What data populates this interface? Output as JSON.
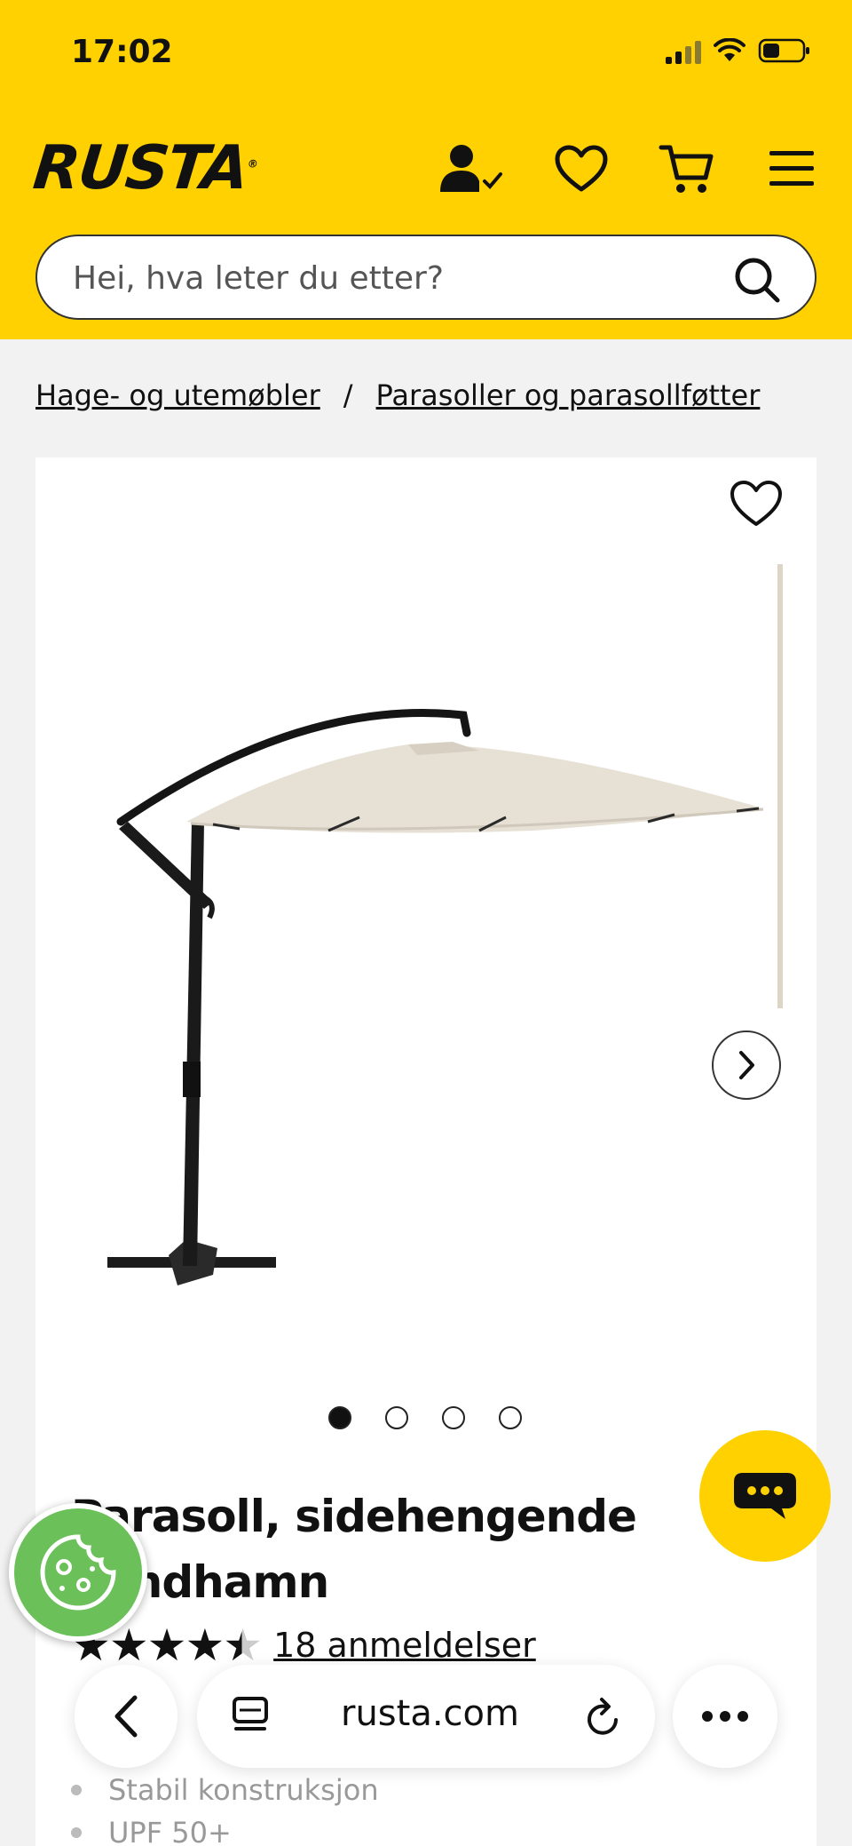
{
  "status_bar": {
    "time": "17:02"
  },
  "header": {
    "logo": "RUSTA",
    "search": {
      "placeholder": "Hei, hva leter du etter?",
      "value": ""
    },
    "colors": {
      "brand": "#ffd100"
    },
    "icons": [
      "account-check-icon",
      "heart-icon",
      "cart-icon",
      "menu-icon"
    ]
  },
  "breadcrumb": {
    "items": [
      {
        "label": "Hage- og utemøbler"
      },
      {
        "label": "Parasoller og parasollføtter"
      }
    ],
    "separator": "/"
  },
  "product": {
    "title": "Parasoll, sidehengende Sandhamn",
    "rating": {
      "stars": 4.5,
      "max": 5
    },
    "reviews_label": "18 anmeldelser",
    "gallery": {
      "image_count": 4,
      "active_index": 0
    },
    "features": [
      "Stabil konstruksjon",
      "UPF 50+"
    ]
  },
  "browser": {
    "url": "rusta.com"
  }
}
